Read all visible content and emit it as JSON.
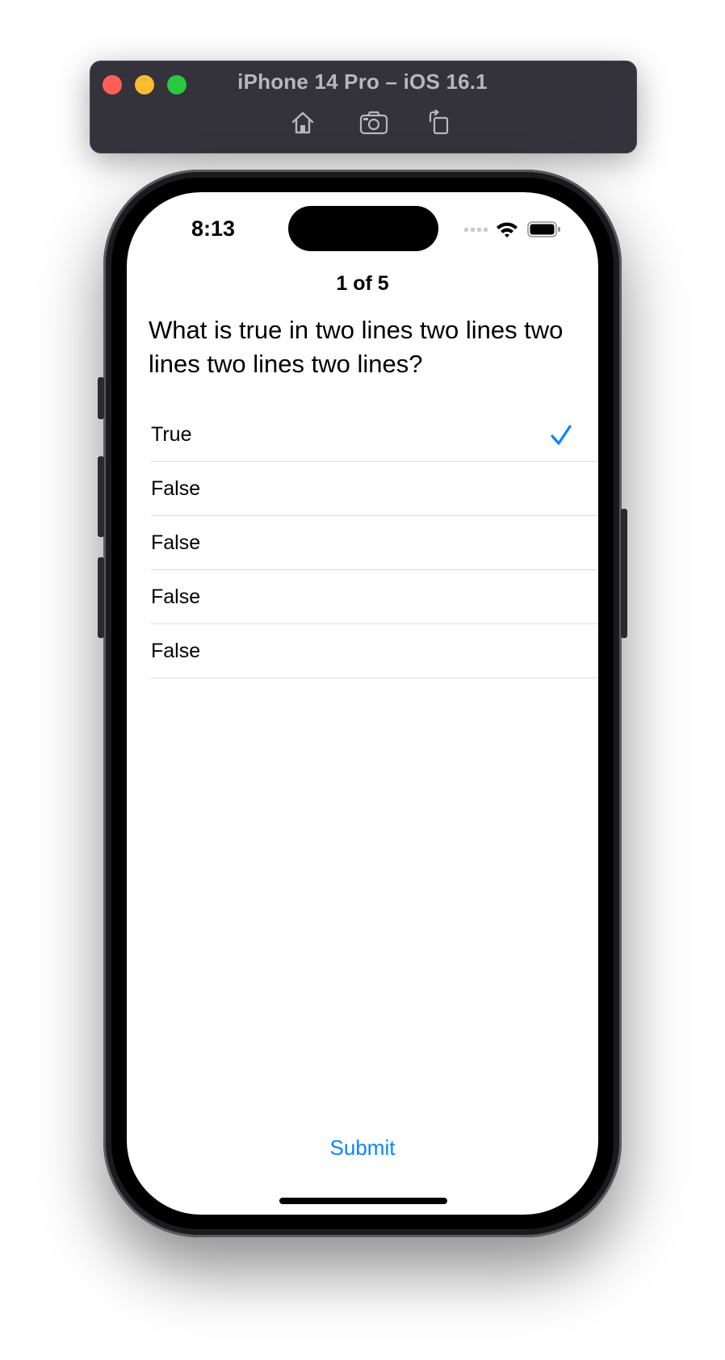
{
  "simulator": {
    "title": "iPhone 14 Pro – iOS 16.1",
    "toolbar": [
      {
        "icon": "home-icon"
      },
      {
        "icon": "screenshot-camera-icon"
      },
      {
        "icon": "rotate-icon"
      }
    ],
    "traffic_lights": {
      "close": "#ff5f57",
      "minimize": "#febc2e",
      "zoom": "#28c840"
    }
  },
  "status_bar": {
    "time": "8:13",
    "icons": [
      "cellular-signal-icon",
      "wifi-icon",
      "battery-icon"
    ]
  },
  "quiz": {
    "progress": "1 of 5",
    "question": "What is true in two lines two lines two lines two lines two lines?",
    "options": [
      {
        "label": "True",
        "selected": true
      },
      {
        "label": "False",
        "selected": false
      },
      {
        "label": "False",
        "selected": false
      },
      {
        "label": "False",
        "selected": false
      },
      {
        "label": "False",
        "selected": false
      }
    ],
    "submit_label": "Submit"
  },
  "colors": {
    "accent": "#0a84ff",
    "separator": "#dcdcde",
    "simulator_bar": "#34323a"
  }
}
